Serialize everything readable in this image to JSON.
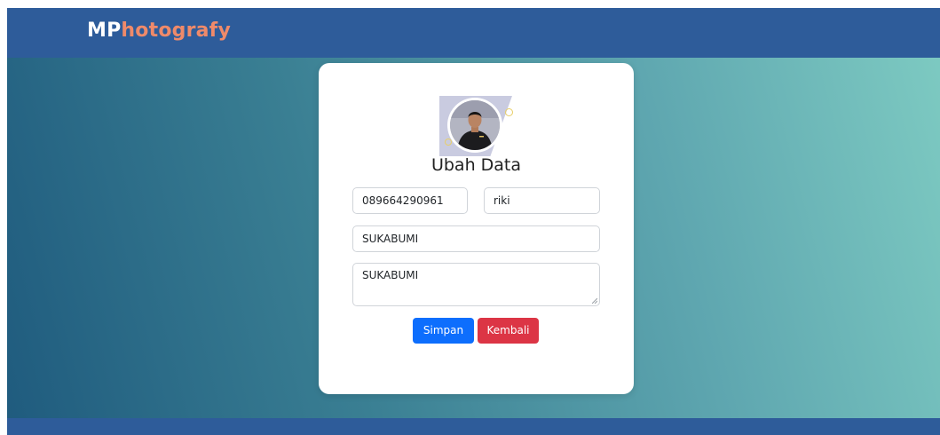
{
  "navbar": {
    "brand_prefix": "MP",
    "brand_suffix": "hotografy"
  },
  "form": {
    "title": "Ubah Data",
    "phone_value": "089664290961",
    "name_value": "riki",
    "city_value": "SUKABUMI",
    "address_value": "SUKABUMI",
    "save_label": "Simpan",
    "back_label": "Kembali"
  },
  "colors": {
    "navbar": "#2e5c9a",
    "brand_accent": "#ef8a6a",
    "save_button": "#0d6efd",
    "back_button": "#dc3545"
  }
}
